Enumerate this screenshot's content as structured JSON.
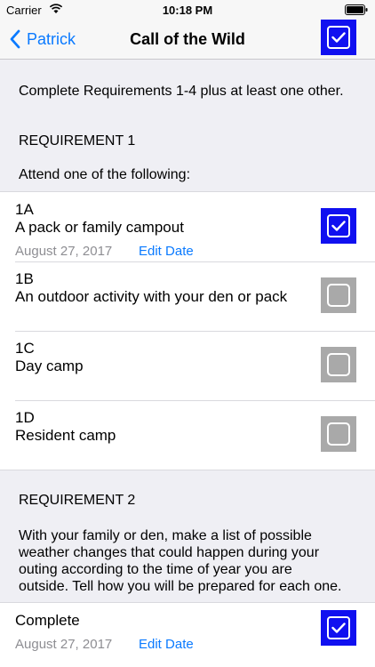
{
  "status": {
    "carrier": "Carrier",
    "time": "10:18 PM"
  },
  "nav": {
    "back_label": "Patrick",
    "title": "Call of the Wild"
  },
  "intro": "Complete Requirements 1-4 plus at least one other.",
  "req1": {
    "header": "REQUIREMENT 1",
    "instruction": "Attend one of the following:",
    "items": [
      {
        "code": "1A",
        "desc": "A pack or family campout",
        "date": "August 27, 2017",
        "edit": "Edit Date",
        "checked": true
      },
      {
        "code": "1B",
        "desc": "An outdoor activity with your den or pack",
        "checked": false
      },
      {
        "code": "1C",
        "desc": "Day camp",
        "checked": false
      },
      {
        "code": "1D",
        "desc": "Resident camp",
        "checked": false
      }
    ]
  },
  "req2": {
    "header": "REQUIREMENT 2",
    "lines": [
      "With your family or den, make a list of possible",
      "weather changes that could happen during your",
      "outing according to the time of year you are",
      "outside. Tell how you will be prepared for each one."
    ],
    "complete": {
      "label": "Complete",
      "date": "August 27, 2017",
      "edit": "Edit Date",
      "checked": true
    }
  },
  "colors": {
    "accent": "#0a7aff",
    "checked": "#1010f0",
    "unchecked": "#a9a9a9"
  }
}
